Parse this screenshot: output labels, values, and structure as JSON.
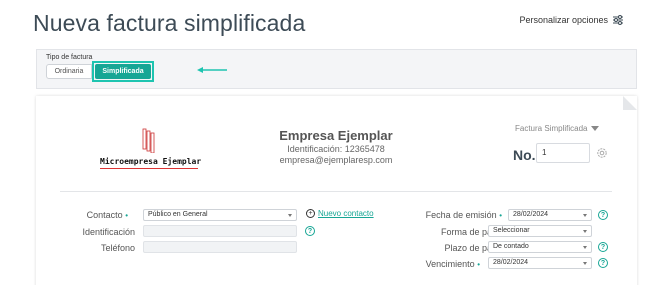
{
  "page": {
    "title": "Nueva factura simplificada",
    "personalize_label": "Personalizar opciones"
  },
  "invoice_type": {
    "label": "Tipo de factura",
    "options": [
      "Ordinaria",
      "Simplificada"
    ],
    "selected": "Simplificada"
  },
  "company": {
    "logo_text": "Microempresa Ejemplar",
    "name": "Empresa Ejemplar",
    "identification": "Identificación: 12365478",
    "email": "empresa@ejemplaresp.com"
  },
  "document": {
    "type_selector": "Factura Simplificada",
    "number_label": "No.",
    "number_value": "1"
  },
  "form_left": {
    "contact_label": "Contacto",
    "contact_value": "Público en General",
    "new_contact_label": "Nuevo contacto",
    "identification_label": "Identificación",
    "phone_label": "Teléfono"
  },
  "form_right": {
    "issue_date_label": "Fecha de emisión",
    "issue_date_value": "28/02/2024",
    "payment_method_label": "Forma de pago",
    "payment_method_value": "Seleccionar",
    "payment_term_label": "Plazo de pago",
    "payment_term_value": "De contado",
    "due_date_label": "Vencimiento",
    "due_date_value": "28/02/2024"
  },
  "colors": {
    "accent": "#17a695",
    "highlight": "#1ec4b0",
    "title": "#3d4b56"
  }
}
